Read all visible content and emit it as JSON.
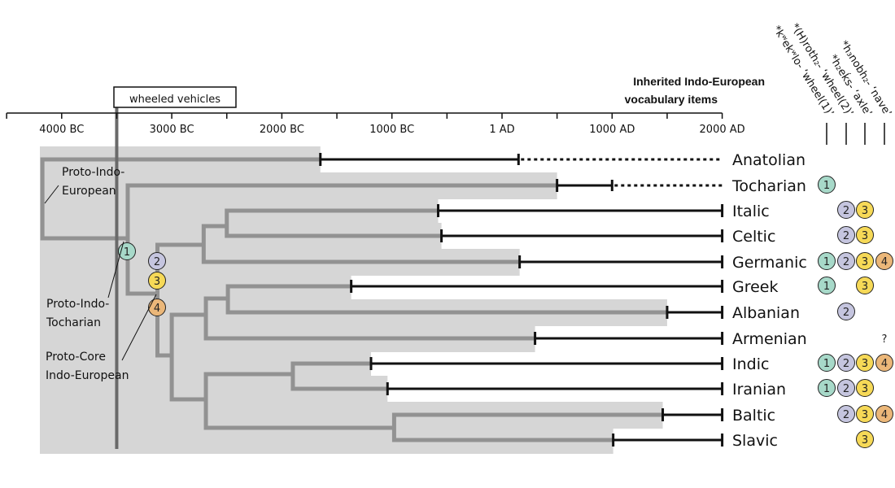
{
  "title_lines": [
    "Inherited Indo-European",
    "vocabulary items"
  ],
  "event_label": "wheeled vehicles",
  "event_year": -3500,
  "axis": {
    "range": [
      -4500,
      2000
    ],
    "major_ticks": [
      -4000,
      -3000,
      -2000,
      -1000,
      0,
      1000,
      2000
    ],
    "minor_ticks": [
      -4500,
      -3500,
      -2500,
      -1500,
      -500,
      500,
      1500
    ],
    "tick_labels": [
      "4000 BC",
      "3000 BC",
      "2000 BC",
      "1000 BC",
      "1 AD",
      "1000 AD",
      "2000 AD"
    ]
  },
  "vocab_items": [
    {
      "id": 1,
      "label": "*kʷekʷlo- ‘wheel(1)’",
      "color": "#a7d9c9"
    },
    {
      "id": 2,
      "label": "*(H)roth₂- ‘wheel(2)’",
      "color": "#c5c5df"
    },
    {
      "id": 3,
      "label": "*h₂eḱs- ‘axle’",
      "color": "#f6d957"
    },
    {
      "id": 4,
      "label": "*h₃nobh₂- ‘nave’",
      "color": "#ebb779"
    }
  ],
  "languages": [
    {
      "name": "Anatolian",
      "attested": -1650,
      "solid_until": 150,
      "extinct": true,
      "items": []
    },
    {
      "name": "Tocharian",
      "attested": 500,
      "solid_until": 1000,
      "extinct": true,
      "items": [
        1
      ]
    },
    {
      "name": "Italic",
      "attested": -580,
      "solid_until": 2000,
      "extinct": false,
      "items": [
        2,
        3
      ]
    },
    {
      "name": "Celtic",
      "attested": -550,
      "solid_until": 2000,
      "extinct": false,
      "items": [
        2,
        3
      ]
    },
    {
      "name": "Germanic",
      "attested": 160,
      "solid_until": 2000,
      "extinct": false,
      "items": [
        1,
        2,
        3,
        4
      ]
    },
    {
      "name": "Greek",
      "attested": -1370,
      "solid_until": 2000,
      "extinct": false,
      "items": [
        1,
        3
      ]
    },
    {
      "name": "Albanian",
      "attested": 1500,
      "solid_until": 2000,
      "extinct": false,
      "items": [
        2
      ]
    },
    {
      "name": "Armenian",
      "attested": 300,
      "solid_until": 2000,
      "extinct": false,
      "items": [],
      "uncertain": {
        "item": 4,
        "mark": "?"
      }
    },
    {
      "name": "Indic",
      "attested": -1190,
      "solid_until": 2000,
      "extinct": false,
      "items": [
        1,
        2,
        3,
        4
      ]
    },
    {
      "name": "Iranian",
      "attested": -1040,
      "solid_until": 2000,
      "extinct": false,
      "items": [
        1,
        2,
        3
      ]
    },
    {
      "name": "Baltic",
      "attested": 1460,
      "solid_until": 2000,
      "extinct": false,
      "items": [
        2,
        3,
        4
      ]
    },
    {
      "name": "Slavic",
      "attested": 1010,
      "solid_until": 2000,
      "extinct": false,
      "items": [
        3
      ]
    }
  ],
  "tree_nodes": [
    {
      "id": "root",
      "year": -4175,
      "children": [
        "Anatolian",
        "pit"
      ]
    },
    {
      "id": "pit",
      "year": -3400,
      "children": [
        "Tocharian",
        "core"
      ],
      "items": [
        1
      ]
    },
    {
      "id": "core",
      "year": -3130,
      "children": [
        "icg",
        "e1"
      ],
      "items": [
        2,
        3,
        4
      ]
    },
    {
      "id": "icg",
      "year": -2710,
      "children": [
        "ic",
        "Germanic"
      ]
    },
    {
      "id": "ic",
      "year": -2500,
      "children": [
        "Italic",
        "Celtic"
      ]
    },
    {
      "id": "e1",
      "year": -3000,
      "children": [
        "gaa",
        "iibs"
      ]
    },
    {
      "id": "gaa",
      "year": -2690,
      "children": [
        "ga",
        "Armenian"
      ]
    },
    {
      "id": "ga",
      "year": -2490,
      "children": [
        "Greek",
        "Albanian"
      ]
    },
    {
      "id": "iibs",
      "year": -2690,
      "children": [
        "ii",
        "bs"
      ]
    },
    {
      "id": "ii",
      "year": -1900,
      "children": [
        "Indic",
        "Iranian"
      ]
    },
    {
      "id": "bs",
      "year": -980,
      "children": [
        "Baltic",
        "Slavic"
      ]
    }
  ],
  "node_labels": [
    {
      "node": "root",
      "lines": [
        "Proto-Indo-",
        "European"
      ]
    },
    {
      "node": "pit",
      "lines": [
        "Proto-Indo-",
        "Tocharian"
      ]
    },
    {
      "node": "core",
      "lines": [
        "Proto-Core",
        "Indo-European"
      ]
    }
  ],
  "colors": {
    "branch": "#929292",
    "band": "#d6d6d6",
    "event_line": "#6a6a6a",
    "bar": "#111111"
  }
}
